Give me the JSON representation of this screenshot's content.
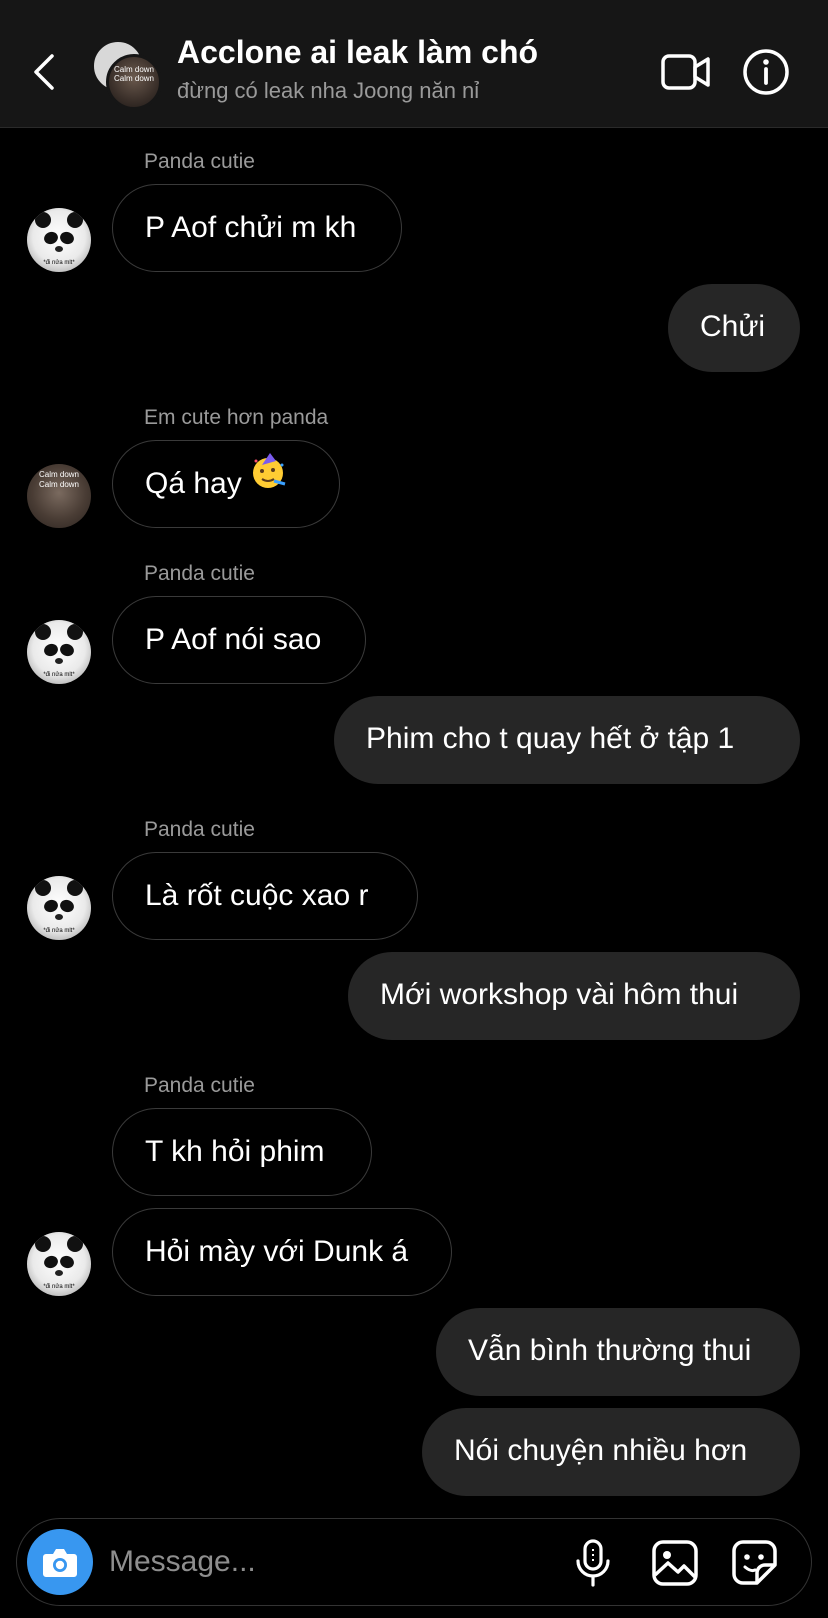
{
  "header": {
    "title": "Acclone ai leak làm chó",
    "subtitle": "đừng có leak nha Joong năn nỉ",
    "group_avatar_caption": "Calm down"
  },
  "avatars": {
    "panda_caption": "*đi nửa mlt*",
    "person_caption": "Calm down"
  },
  "messages": [
    {
      "side": "in",
      "sender": "Panda cutie",
      "text": "P Aof chửi m kh"
    },
    {
      "side": "out",
      "text": "Chửi"
    },
    {
      "side": "in",
      "sender": "Em cute hơn panda",
      "text": "Qá hay",
      "emoji": "partying-face"
    },
    {
      "side": "in",
      "sender": "Panda cutie",
      "text": "P Aof nói sao"
    },
    {
      "side": "out",
      "text": "Phim cho t quay hết ở tập 1"
    },
    {
      "side": "in",
      "sender": "Panda cutie",
      "text": "Là rốt cuộc xao r"
    },
    {
      "side": "out",
      "text": "Mới workshop vài hôm thui"
    },
    {
      "side": "in",
      "sender": "Panda cutie",
      "text": "T kh hỏi phim"
    },
    {
      "side": "in",
      "text": "Hỏi mày với Dunk á"
    },
    {
      "side": "out",
      "text": "Vẫn bình thường thui"
    },
    {
      "side": "out",
      "text": "Nói chuyện nhiều hơn"
    }
  ],
  "composer": {
    "placeholder": "Message..."
  },
  "colors": {
    "header_bg": "#161616",
    "outgoing_bubble": "#262626",
    "camera_button": "#3897f0",
    "secondary_text": "#9a9a9a"
  }
}
